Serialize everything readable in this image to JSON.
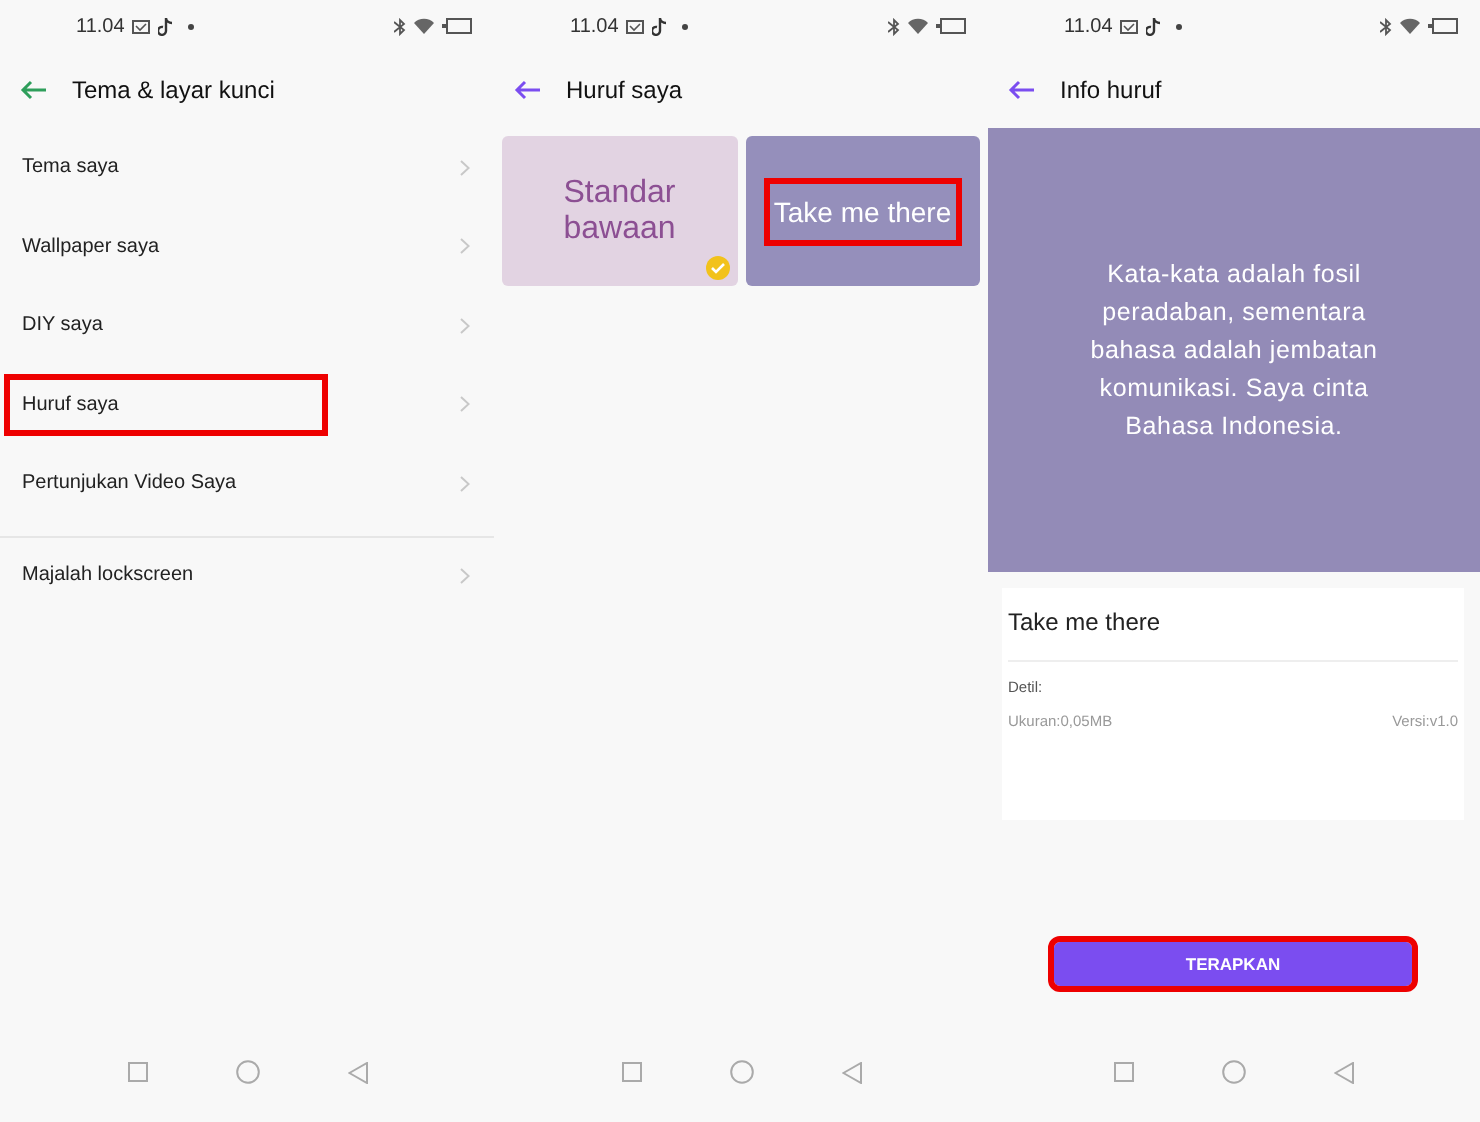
{
  "screens": [
    {
      "kind": "menu",
      "status_time": "11.04",
      "title": "Tema & layar kunci",
      "items": [
        {
          "label": "Tema saya",
          "highlighted": false,
          "separated": false
        },
        {
          "label": "Wallpaper saya",
          "highlighted": false,
          "separated": false
        },
        {
          "label": "DIY saya",
          "highlighted": false,
          "separated": false
        },
        {
          "label": "Huruf saya",
          "highlighted": true,
          "separated": false
        },
        {
          "label": "Pertunjukan Video Saya",
          "highlighted": false,
          "separated": false
        },
        {
          "label": "Majalah lockscreen",
          "highlighted": false,
          "separated": true
        }
      ]
    },
    {
      "kind": "fonts",
      "status_time": "11.04",
      "title": "Huruf saya",
      "fonts": [
        {
          "label": "Standar bawaan",
          "selected": true,
          "highlighted": false
        },
        {
          "label": "Take me there",
          "selected": false,
          "highlighted": true
        }
      ]
    },
    {
      "kind": "info",
      "status_time": "11.04",
      "title": "Info huruf",
      "preview": "Kata-kata adalah fosil peradaban, sementara bahasa adalah jembatan komunikasi. Saya cinta Bahasa Indonesia.",
      "font_name": "Take me there",
      "detail_label": "Detil:",
      "size": "Ukuran:0,05MB",
      "version": "Versi:v1.0",
      "apply": {
        "label": "TERAPKAN",
        "highlighted": true
      }
    }
  ]
}
